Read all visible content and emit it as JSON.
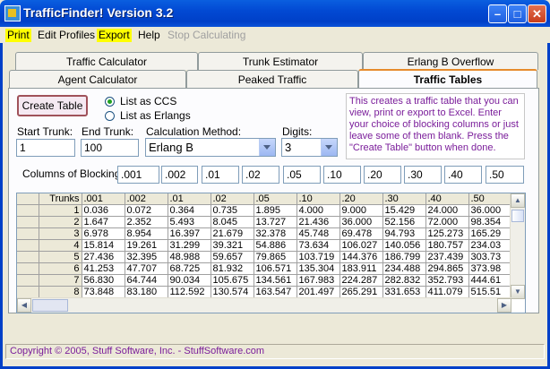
{
  "window": {
    "title": "TrafficFinder! Version 3.2"
  },
  "menu": [
    {
      "label": "Print",
      "highlight": true,
      "disabled": false
    },
    {
      "label": "Edit Profiles",
      "highlight": false,
      "disabled": false
    },
    {
      "label": "Export",
      "highlight": true,
      "disabled": false
    },
    {
      "label": "Help",
      "highlight": false,
      "disabled": false
    },
    {
      "label": "Stop Calculating",
      "highlight": false,
      "disabled": true
    }
  ],
  "tabs": {
    "row1": [
      "Traffic Calculator",
      "Trunk Estimator",
      "Erlang B Overflow"
    ],
    "row2": [
      "Agent Calculator",
      "Peaked Traffic",
      "Traffic Tables"
    ],
    "active": "Traffic Tables"
  },
  "form": {
    "create_button": "Create Table",
    "radio_ccs": "List as CCS",
    "radio_erlangs": "List as Erlangs",
    "selected_radio": "List as CCS",
    "start_trunk_label": "Start Trunk:",
    "start_trunk_value": "1",
    "end_trunk_label": "End Trunk:",
    "end_trunk_value": "100",
    "calc_method_label": "Calculation Method:",
    "calc_method_value": "Erlang B",
    "digits_label": "Digits:",
    "digits_value": "3",
    "blocking_label": "Columns of Blocking:",
    "blocking_values": [
      ".001",
      ".002",
      ".01",
      ".02",
      ".05",
      ".10",
      ".20",
      ".30",
      ".40",
      ".50"
    ]
  },
  "info_text": "This creates a traffic table that you can view, print or export to Excel.  Enter your choice of blocking columns or just leave some of them blank.  Press the \"Create Table\" button when done.",
  "table": {
    "headers": [
      "Trunks",
      ".001",
      ".002",
      ".01",
      ".02",
      ".05",
      ".10",
      ".20",
      ".30",
      ".40",
      ".50"
    ],
    "rows": [
      [
        "1",
        "0.036",
        "0.072",
        "0.364",
        "0.735",
        "1.895",
        "4.000",
        "9.000",
        "15.429",
        "24.000",
        "36.000"
      ],
      [
        "2",
        "1.647",
        "2.352",
        "5.493",
        "8.045",
        "13.727",
        "21.436",
        "36.000",
        "52.156",
        "72.000",
        "98.354"
      ],
      [
        "3",
        "6.978",
        "8.954",
        "16.397",
        "21.679",
        "32.378",
        "45.748",
        "69.478",
        "94.793",
        "125.273",
        "165.29"
      ],
      [
        "4",
        "15.814",
        "19.261",
        "31.299",
        "39.321",
        "54.886",
        "73.634",
        "106.027",
        "140.056",
        "180.757",
        "234.03"
      ],
      [
        "5",
        "27.436",
        "32.395",
        "48.988",
        "59.657",
        "79.865",
        "103.719",
        "144.376",
        "186.799",
        "237.439",
        "303.73"
      ],
      [
        "6",
        "41.253",
        "47.707",
        "68.725",
        "81.932",
        "106.571",
        "135.304",
        "183.911",
        "234.488",
        "294.865",
        "373.98"
      ],
      [
        "7",
        "56.830",
        "64.744",
        "90.034",
        "105.675",
        "134.561",
        "167.983",
        "224.287",
        "282.832",
        "352.793",
        "444.61"
      ],
      [
        "8",
        "73.848",
        "83.180",
        "112.592",
        "130.574",
        "163.547",
        "201.497",
        "265.291",
        "331.653",
        "411.079",
        "515.51"
      ]
    ]
  },
  "status": "Copyright © 2005, Stuff Software, Inc. - StuffSoftware.com"
}
